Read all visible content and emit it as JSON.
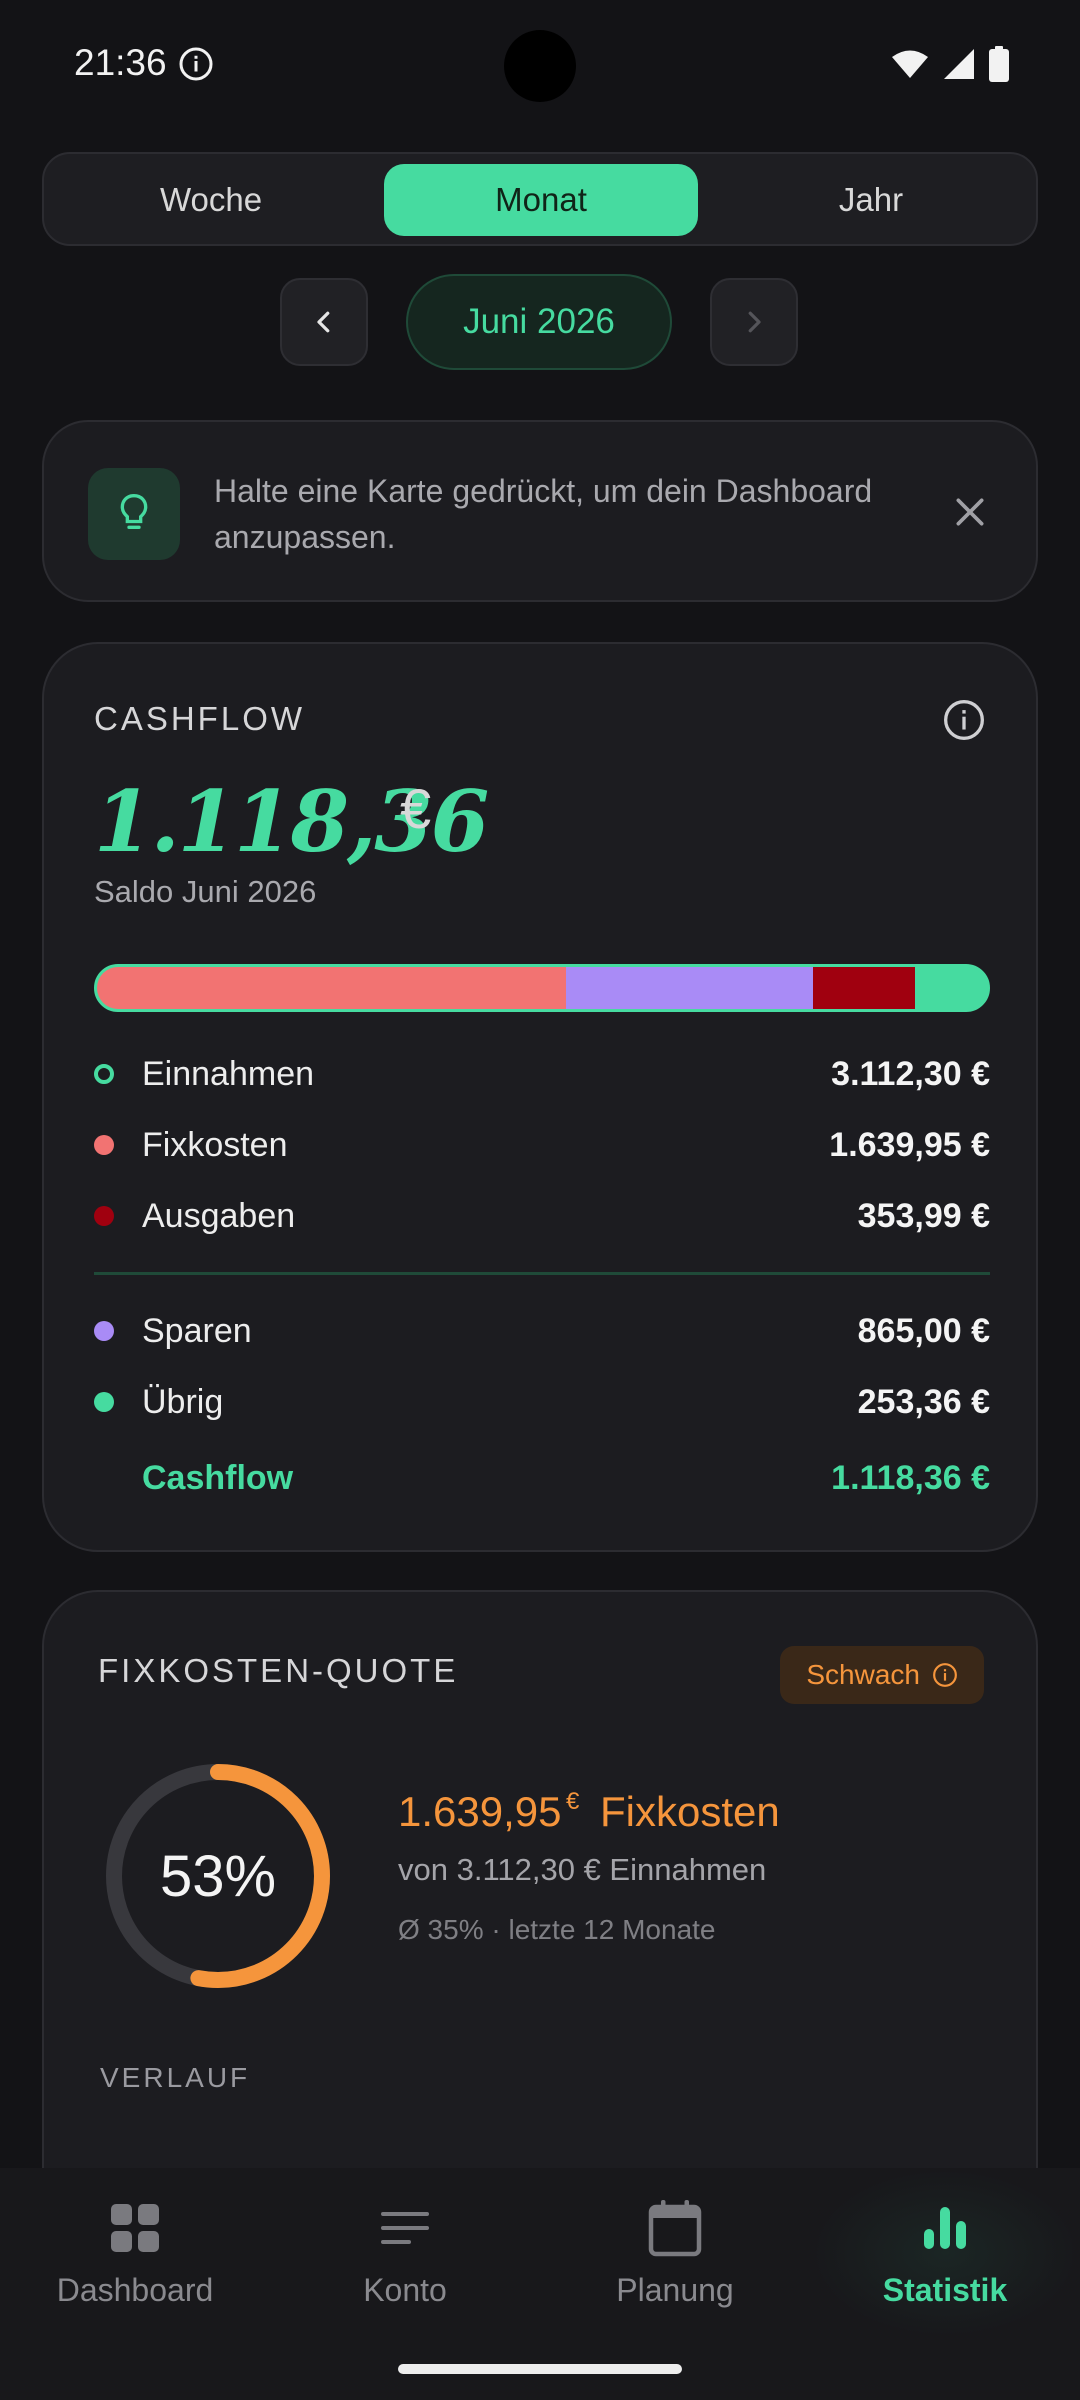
{
  "status_bar": {
    "time": "21:36"
  },
  "period_tabs": [
    {
      "label": "Woche",
      "active": false
    },
    {
      "label": "Monat",
      "active": true
    },
    {
      "label": "Jahr",
      "active": false
    }
  ],
  "period": {
    "label": "Juni 2026"
  },
  "tip": {
    "text": "Halte eine Karte gedrückt, um dein Dashboard anzupassen."
  },
  "cashflow": {
    "title": "CASHFLOW",
    "amount": "1.118,36",
    "currency": "€",
    "subtitle": "Saldo Juni 2026",
    "bar_shares": {
      "fixkosten": 0.527,
      "sparen": 0.278,
      "ausgaben": 0.114,
      "uebrig": 0.081
    },
    "rows": [
      {
        "label": "Einnahmen",
        "value": "3.112,30 €",
        "color": "#46DBA0"
      },
      {
        "label": "Fixkosten",
        "value": "1.639,95 €",
        "color": "#F27372"
      },
      {
        "label": "Ausgaben",
        "value": "353,99 €",
        "color": "#A0000F"
      },
      {
        "label": "Sparen",
        "value": "865,00 €",
        "color": "#A98BF6"
      },
      {
        "label": "Übrig",
        "value": "253,36 €",
        "color": "#46DBA0"
      }
    ],
    "total": {
      "label": "Cashflow",
      "value": "1.118,36 €"
    }
  },
  "fixkosten_quote": {
    "title": "FIXKOSTEN-QUOTE",
    "badge": "Schwach",
    "percent_label": "53%",
    "percent": 53,
    "amount": "1.639,95",
    "currency": "€",
    "label": "Fixkosten",
    "sub": "von 3.112,30 € Einnahmen",
    "avg": "Ø 35% · letzte 12 Monate",
    "section": "VERLAUF"
  },
  "colors": {
    "accent": "#46DBA0",
    "warning": "#F5953C",
    "fixkosten": "#F27372",
    "ausgaben": "#A0000F",
    "sparen": "#A98BF6"
  },
  "bottom_nav": [
    {
      "label": "Dashboard",
      "icon": "grid-icon",
      "active": false
    },
    {
      "label": "Konto",
      "icon": "list-lines-icon",
      "active": false
    },
    {
      "label": "Planung",
      "icon": "calendar-icon",
      "active": false
    },
    {
      "label": "Statistik",
      "icon": "bar-chart-icon",
      "active": true
    }
  ]
}
